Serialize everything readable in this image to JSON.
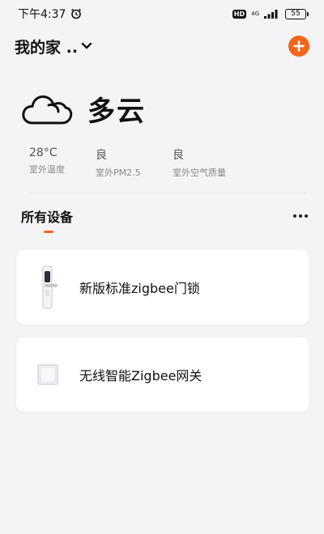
{
  "status_bar": {
    "time": "下午4:37",
    "hd": "HD",
    "network": "4G",
    "battery": "55"
  },
  "header": {
    "home_name": "我的家 .."
  },
  "weather": {
    "condition": "多云",
    "icon": "cloud-icon"
  },
  "environment": [
    {
      "value": "28°C",
      "label": "室外温度"
    },
    {
      "value": "良",
      "label": "室外PM2.5"
    },
    {
      "value": "良",
      "label": "室外空气质量"
    }
  ],
  "devices": {
    "title": "所有设备",
    "items": [
      {
        "name": "新版标准zigbee门锁",
        "icon": "door-lock-icon"
      },
      {
        "name": "无线智能Zigbee网关",
        "icon": "gateway-icon"
      }
    ]
  },
  "colors": {
    "accent": "#f2661c",
    "background": "#f4f4f6",
    "card": "#ffffff"
  }
}
